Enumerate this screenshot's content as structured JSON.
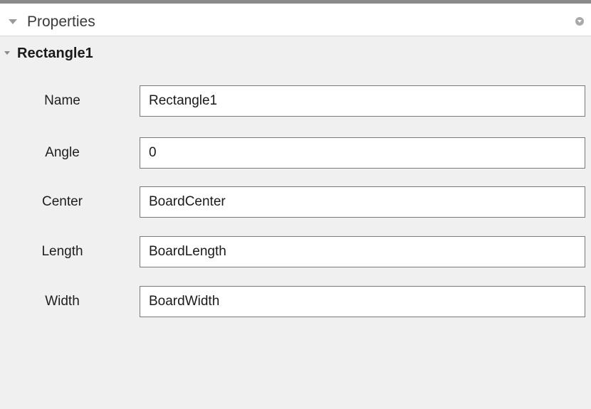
{
  "panel": {
    "title": "Properties"
  },
  "section": {
    "title": "Rectangle1"
  },
  "properties": [
    {
      "label": "Name",
      "value": "Rectangle1"
    },
    {
      "label": "Angle",
      "value": "0"
    },
    {
      "label": "Center",
      "value": "BoardCenter"
    },
    {
      "label": "Length",
      "value": "BoardLength"
    },
    {
      "label": "Width",
      "value": "BoardWidth"
    }
  ]
}
